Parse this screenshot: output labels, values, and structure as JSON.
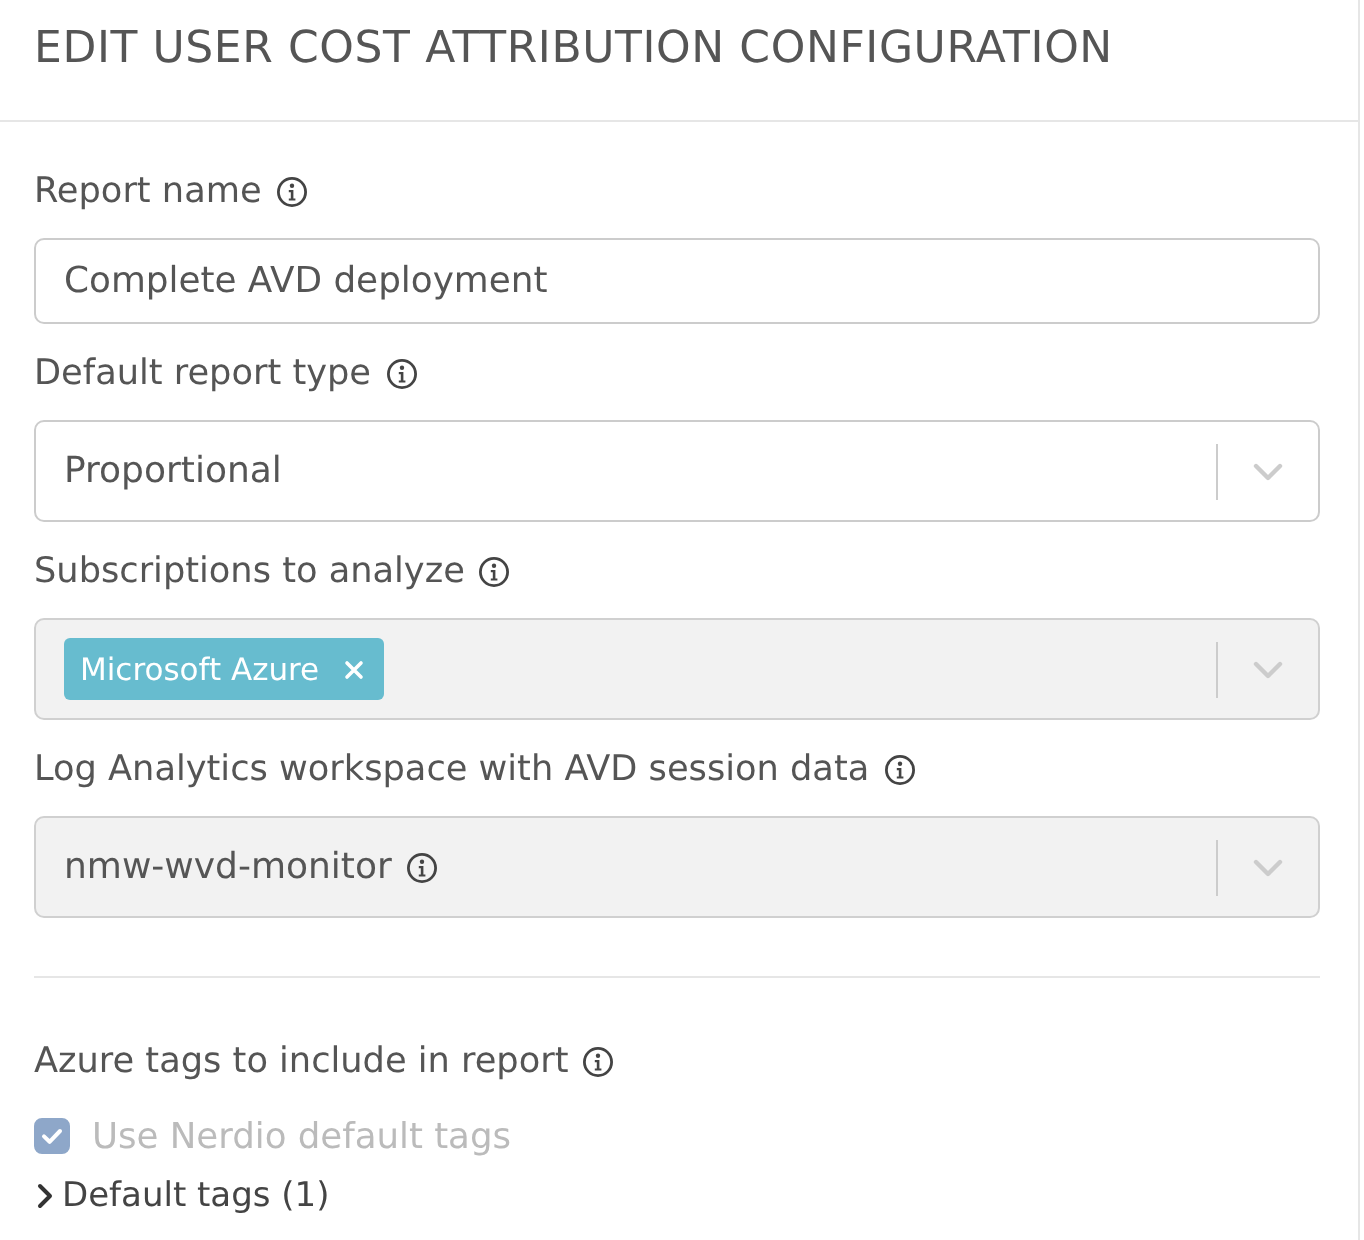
{
  "header": {
    "title": "EDIT USER COST ATTRIBUTION CONFIGURATION"
  },
  "fields": [
    {
      "kind": "text",
      "label": "Report name",
      "value": "Complete AVD deployment",
      "disabled": false
    },
    {
      "kind": "select",
      "label": "Default report type",
      "value": "Proportional",
      "disabled": false
    },
    {
      "kind": "multiselect",
      "label": "Subscriptions to analyze",
      "tags": [
        {
          "label": "Microsoft Azure"
        }
      ],
      "disabled": true
    },
    {
      "kind": "select",
      "label": "Log Analytics workspace with AVD session data",
      "value": "nmw-wvd-monitor",
      "value_info": true,
      "disabled": true
    }
  ],
  "tags_section": {
    "label": "Azure tags to include in report",
    "checkbox": {
      "label": "Use Nerdio default tags",
      "checked": true,
      "disabled": true
    },
    "expander": {
      "label": "Default tags (1)",
      "expanded": false
    }
  }
}
